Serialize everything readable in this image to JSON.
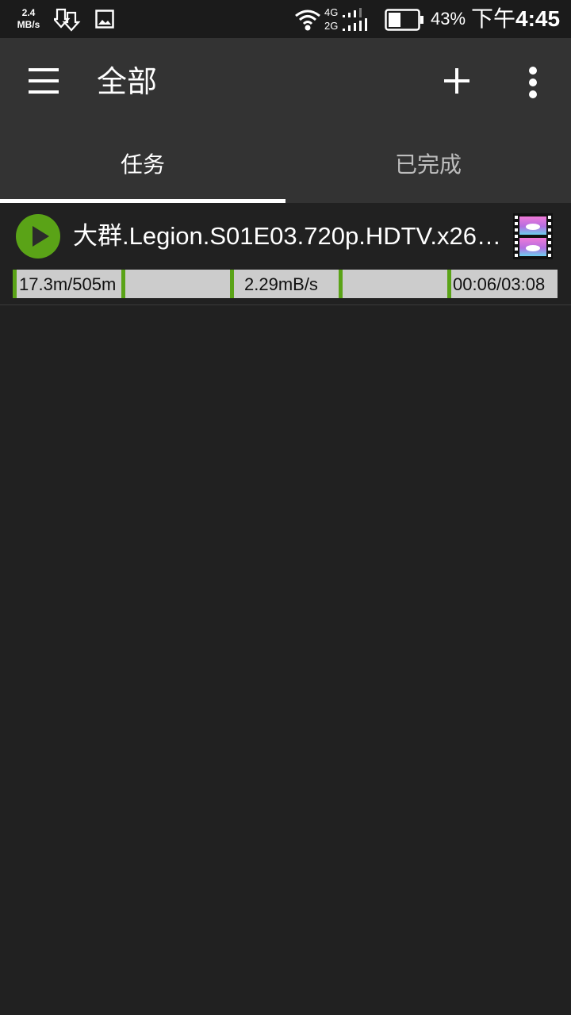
{
  "status_bar": {
    "speed_value": "2.4",
    "speed_unit": "MB/s",
    "download_icon": "download-arrows-icon",
    "image_icon": "image-notification-icon",
    "wifi_icon": "wifi-icon",
    "net_4g": "4G",
    "net_2g": "2G",
    "battery_level": 43,
    "battery_percent": "43%",
    "time_ampm": "下午",
    "time_clock": "4:45"
  },
  "app_bar": {
    "title": "全部",
    "menu_icon": "hamburger-menu-icon",
    "add_icon": "plus-icon",
    "more_icon": "more-vertical-icon",
    "background_color": "#333333"
  },
  "tabs": [
    {
      "label": "任务",
      "active": true
    },
    {
      "label": "已完成",
      "active": false
    }
  ],
  "tasks": [
    {
      "name": "大群.Legion.S01E03.720p.HDTV.x26…",
      "progress_text": "17.3m/505m",
      "speed_text": "2.29mB/s",
      "time_text": "00:06/03:08",
      "play_icon": "play-icon",
      "file_type_icon": "video-file-icon",
      "accent_color": "#5aa317"
    }
  ]
}
